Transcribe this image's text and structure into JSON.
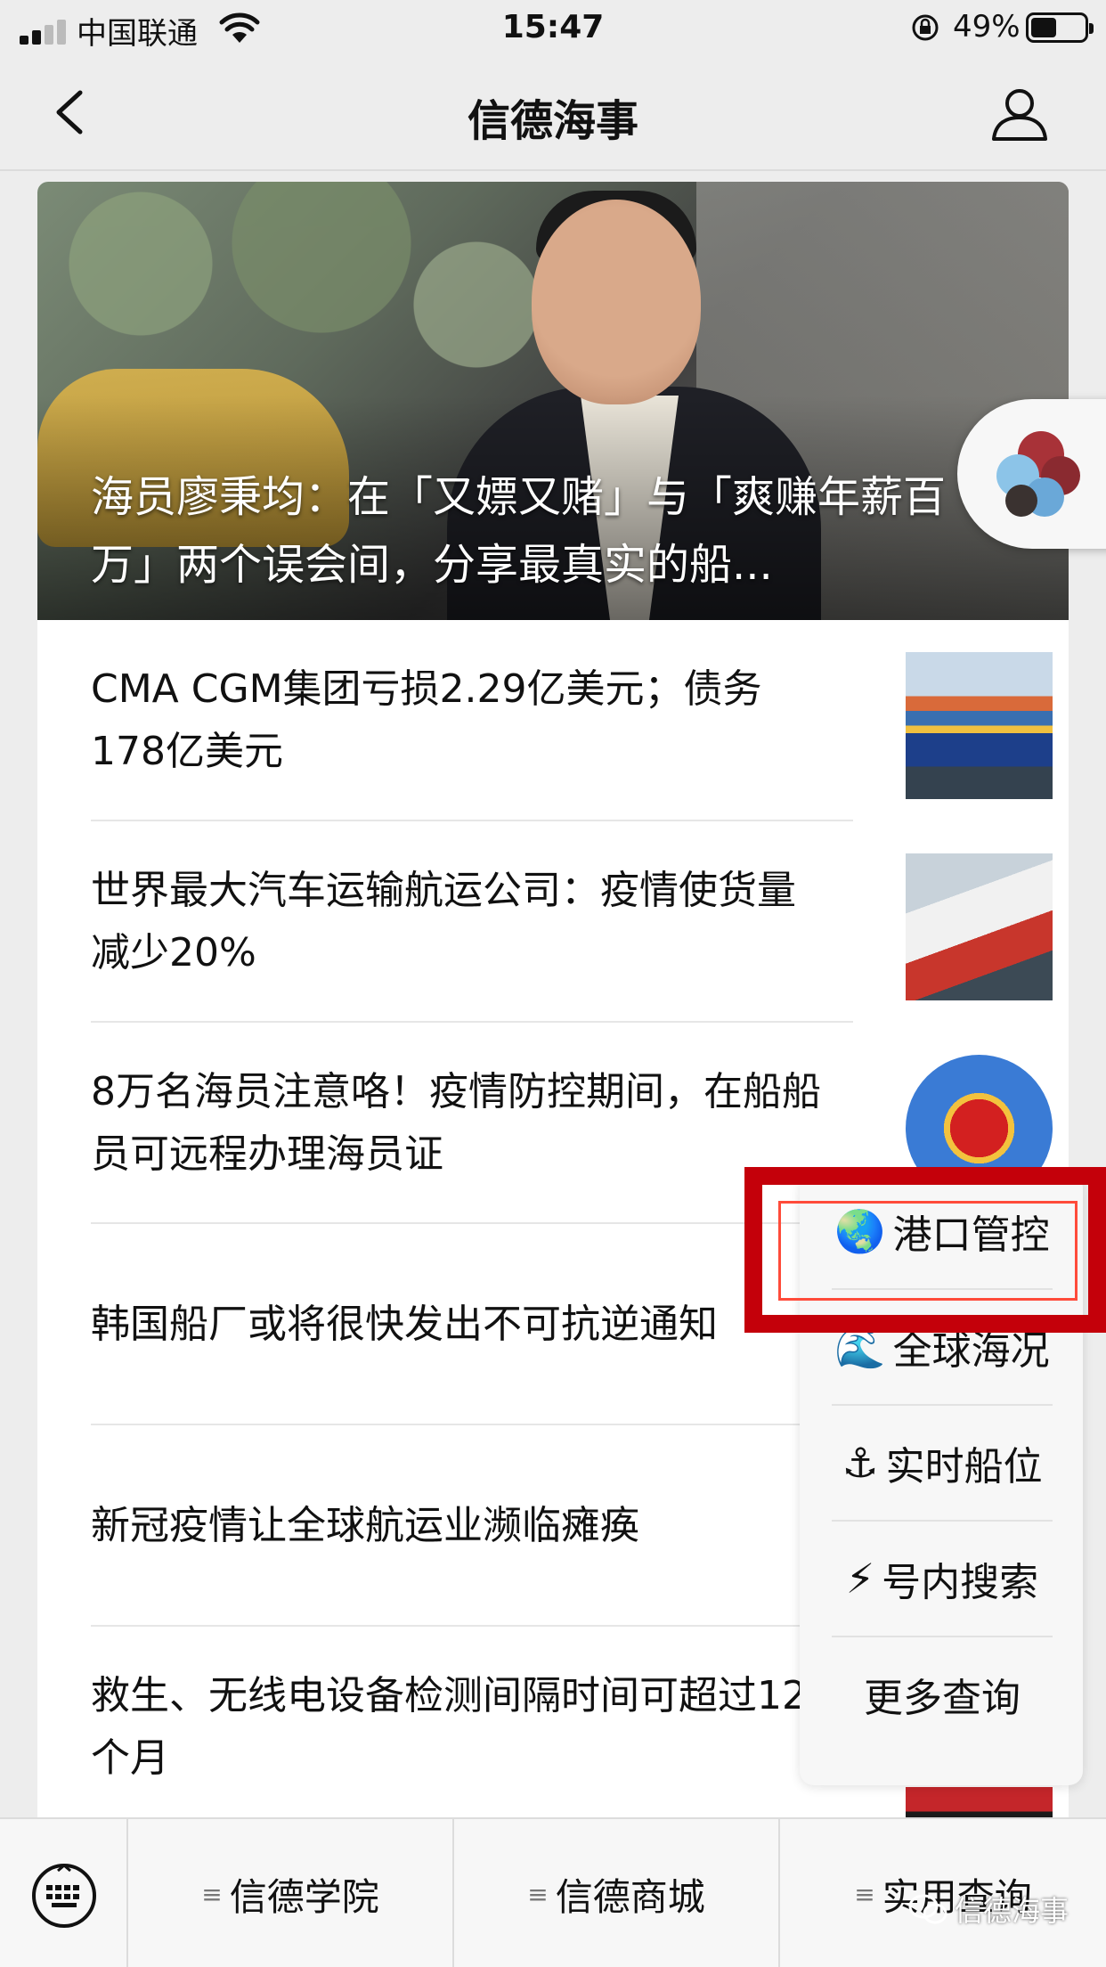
{
  "status_bar": {
    "carrier": "中国联通",
    "time": "15:47",
    "battery": "49%"
  },
  "nav": {
    "title": "信德海事"
  },
  "hero": {
    "caption": "海员廖秉均：在「又嫖又赌」与「爽赚年薪百万」两个误会间，分享最真实的船..."
  },
  "articles": [
    {
      "title": "CMA CGM集团亏损2.29亿美元；债务178亿美元",
      "thumb": "container-ship"
    },
    {
      "title": "世界最大汽车运输航运公司：疫情使货量减少20%",
      "thumb": "car-carrier-ship"
    },
    {
      "title": "8万名海员注意咯！疫情防控期间，在船船员可远程办理海员证",
      "thumb": "national-emblem"
    },
    {
      "title": "韩国船厂或将很快发出不可抗逆通知",
      "thumb": ""
    },
    {
      "title": "新冠疫情让全球航运业濒临瘫痪",
      "thumb": ""
    },
    {
      "title": "救生、无线电设备检测间隔时间可超过12个月",
      "thumb": "lifesaving-equipment"
    }
  ],
  "menu": {
    "items": [
      {
        "icon": "🌏",
        "label": "港口管控"
      },
      {
        "icon": "🌊",
        "label": "全球海况"
      },
      {
        "icon": "⚓",
        "label": "实时船位"
      },
      {
        "icon": "⚡",
        "label": "号内搜索"
      },
      {
        "icon": "",
        "label": "更多查询"
      }
    ],
    "highlight_color": "#c4000a"
  },
  "bottom_tabs": [
    {
      "label": "信德学院"
    },
    {
      "label": "信德商城"
    },
    {
      "label": "实用查询"
    }
  ],
  "watermark": "信德海事"
}
